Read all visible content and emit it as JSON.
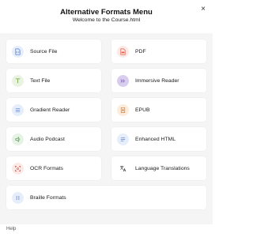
{
  "header": {
    "title": "Alternative Formats Menu",
    "subtitle": "Welcome to the Course.html",
    "close_icon": "×"
  },
  "formats": [
    {
      "label": "Source File",
      "icon": "code-file-icon",
      "color": "#4a7fd6",
      "bg": "#e6eefb"
    },
    {
      "label": "PDF",
      "icon": "pdf-file-icon",
      "color": "#e05a4a",
      "bg": "#fde9e6"
    },
    {
      "label": "Text File",
      "icon": "text-icon",
      "color": "#7dab55",
      "bg": "#eaf3e2"
    },
    {
      "label": "Immersive Reader",
      "icon": "immersive-reader-icon",
      "color": "#7b5fb8",
      "bg": "#d9cdef"
    },
    {
      "label": "Gradient Reader",
      "icon": "gradient-reader-icon",
      "color": "#5a7fd6",
      "bg": "#e6eefb"
    },
    {
      "label": "EPUB",
      "icon": "epub-icon",
      "color": "#d9843d",
      "bg": "#fcecdc"
    },
    {
      "label": "Audio Podcast",
      "icon": "audio-icon",
      "color": "#5ca35a",
      "bg": "#e6f3e4"
    },
    {
      "label": "Enhanced HTML",
      "icon": "html-icon",
      "color": "#5a7fd6",
      "bg": "#e6eefb"
    },
    {
      "label": "OCR Formats",
      "icon": "ocr-icon",
      "color": "#e05a4a",
      "bg": "#fde9e6"
    },
    {
      "label": "Language Translations",
      "icon": "translate-icon",
      "color": "#333333",
      "bg": "#ffffff"
    },
    {
      "label": "Braille Formats",
      "icon": "braille-icon",
      "color": "#5a7fd6",
      "bg": "#e6eefb"
    }
  ],
  "footer": {
    "help_label": "Help"
  }
}
